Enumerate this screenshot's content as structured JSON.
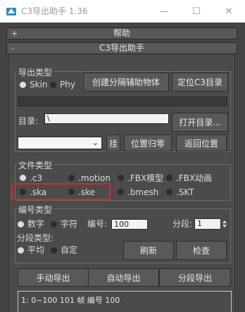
{
  "window": {
    "title": "C3导出助手 1.36",
    "minimize_glyph": "—",
    "maximize_glyph": "☐",
    "close_glyph": "✕"
  },
  "rollouts": {
    "help": {
      "sign": "+",
      "title": "帮助"
    },
    "main": {
      "sign": "-",
      "title": "C3导出助手"
    }
  },
  "export_type": {
    "label": "导出类型",
    "options": [
      {
        "label": "Skin",
        "selected": true
      },
      {
        "label": "Phy",
        "selected": false
      }
    ],
    "create_dummy_button": "创建分隔辅助物体",
    "locate_dir_button": "定位C3目录"
  },
  "directory": {
    "label": "目录:",
    "value": "\\",
    "open_button": "打开目录..."
  },
  "position": {
    "hang_button": "挂",
    "reset_button": "位置归零",
    "return_button": "返回位置"
  },
  "file_type": {
    "label": "文件类型",
    "options": [
      {
        "label": ".c3",
        "selected": true
      },
      {
        "label": ".motion",
        "selected": false
      },
      {
        "label": ".FBX模型",
        "selected": false
      },
      {
        "label": ".FBX动画",
        "selected": false
      },
      {
        "label": ".ska",
        "selected": false
      },
      {
        "label": ".ske",
        "selected": false
      },
      {
        "label": ".bmesh",
        "selected": false
      },
      {
        "label": ".SKT",
        "selected": false
      }
    ]
  },
  "number_type": {
    "label": "编号类型",
    "options": [
      {
        "label": "数字",
        "selected": true
      },
      {
        "label": "字符",
        "selected": false
      }
    ],
    "number_label": "编号:",
    "number_value": "100",
    "segment_label": "分段:",
    "segment_value": "1"
  },
  "segment_type": {
    "label": "分段类型:",
    "options": [
      {
        "label": "平均",
        "selected": true
      },
      {
        "label": "自定",
        "selected": false
      }
    ],
    "refresh_button": "刷新",
    "check_button": "检查"
  },
  "export_buttons": {
    "manual": "手动导出",
    "auto": "自动导出",
    "segment": "分段导出"
  },
  "list": {
    "items": [
      "1: 0~100 101 帧 编号 100"
    ]
  },
  "colors": {
    "highlight_box": "#e0231f",
    "panel_bg": "#444444",
    "titlebar_bg": "#ffffff"
  }
}
